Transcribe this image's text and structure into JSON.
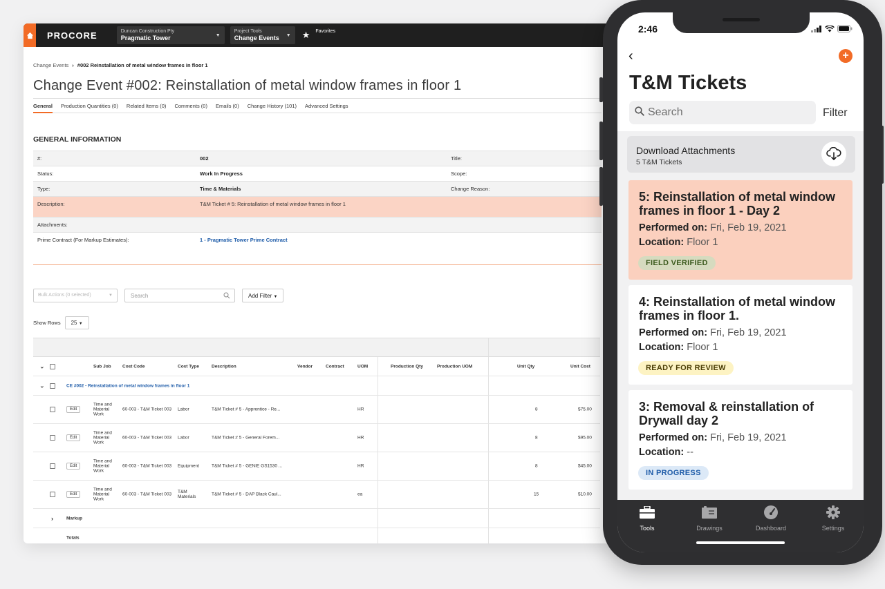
{
  "app": {
    "logo": "PROCORE",
    "company_small": "Duncan Construction Pty",
    "company_big": "Pragmatic Tower",
    "tools_small": "Project Tools",
    "tools_big": "Change Events",
    "favorites": "Favorites"
  },
  "breadcrumb": {
    "parent": "Change Events",
    "current": "#002 Reinstallation of metal window frames in floor 1"
  },
  "page_title": "Change Event #002: Reinstallation of metal window frames in floor 1",
  "tabs": [
    "General",
    "Production Quantities (0)",
    "Related Items (0)",
    "Comments (0)",
    "Emails (0)",
    "Change History (101)",
    "Advanced Settings"
  ],
  "general_info": {
    "heading": "GENERAL INFORMATION",
    "rows": [
      {
        "label": "#:",
        "value": "002",
        "label2": "Title:"
      },
      {
        "label": "Status:",
        "value": "Work In Progress",
        "label2": "Scope:"
      },
      {
        "label": "Type:",
        "value": "Time & Materials",
        "label2": "Change Reason:"
      },
      {
        "label": "Description:",
        "value": "T&M Ticket # 5: Reinstallation of metal window frames in floor 1",
        "label2": ""
      },
      {
        "label": "Attachments:",
        "value": "",
        "label2": ""
      },
      {
        "label": "Prime Contract (For Markup Estimates):",
        "value": "1 - Pragmatic Tower Prime Contract",
        "label2": ""
      }
    ]
  },
  "toolbar": {
    "bulk": "Bulk Actions (0 selected)",
    "search_placeholder": "Search",
    "add_filter": "Add Filter",
    "show_rows_label": "Show Rows",
    "show_rows_value": "25"
  },
  "grid": {
    "headers": {
      "sub_job": "Sub Job",
      "cost_code": "Cost Code",
      "cost_type": "Cost Type",
      "description": "Description",
      "vendor": "Vendor",
      "contract": "Contract",
      "uom": "UOM",
      "prod_qty": "Production Qty",
      "prod_uom": "Production UOM",
      "unit_qty": "Unit Qty",
      "unit_cost": "Unit Cost"
    },
    "group": "CE #002 - Reinstallation of metal window frames in floor 1",
    "edit_label": "Edit",
    "rows": [
      {
        "sub": "Time and Material Work",
        "code": "60-003 - T&M Ticket 003",
        "type": "Labor",
        "desc": "T&M Ticket # 5 - Apprentice - Re...",
        "uom": "HR",
        "qty": "8",
        "cost": "$75.00"
      },
      {
        "sub": "Time and Material Work",
        "code": "60-003 - T&M Ticket 003",
        "type": "Labor",
        "desc": "T&M Ticket # 5 - General Forem...",
        "uom": "HR",
        "qty": "8",
        "cost": "$95.00"
      },
      {
        "sub": "Time and Material Work",
        "code": "60-003 - T&M Ticket 003",
        "type": "Equipment",
        "desc": "T&M Ticket # 5 - GENIE GS1530 ...",
        "uom": "HR",
        "qty": "8",
        "cost": "$45.00"
      },
      {
        "sub": "Time and Material Work",
        "code": "60-003 - T&M Ticket 003",
        "type": "T&M Materials",
        "desc": "T&M Ticket # 5 - DAP Black Caul...",
        "uom": "ea",
        "qty": "15",
        "cost": "$10.00"
      }
    ],
    "markup": "Markup",
    "totals": "Totals"
  },
  "phone": {
    "time": "2:46",
    "title": "T&M Tickets",
    "search_placeholder": "Search",
    "filter": "Filter",
    "download_title": "Download Attachments",
    "download_sub": "5 T&M Tickets",
    "performed_label": "Performed on:",
    "location_label": "Location:",
    "cards": [
      {
        "title": "5: Reinstallation of metal window frames in floor 1 - Day 2",
        "date": "Fri, Feb 19, 2021",
        "location": "Floor 1",
        "badge": "FIELD VERIFIED",
        "badge_bg": "#d9dcc4",
        "badge_fg": "#3b5a1d"
      },
      {
        "title": "4: Reinstallation of metal window frames in floor 1.",
        "date": "Fri, Feb 19, 2021",
        "location": "Floor 1",
        "badge": "READY FOR REVIEW",
        "badge_bg": "#fdf3c3",
        "badge_fg": "#4a3d05"
      },
      {
        "title": "3: Removal & reinstallation of Drywall day 2",
        "date": "Fri, Feb 19, 2021",
        "location": "--",
        "badge": "IN PROGRESS",
        "badge_bg": "#dce9f7",
        "badge_fg": "#1d5ba8"
      }
    ],
    "tabbar": [
      "Tools",
      "Drawings",
      "Dashboard",
      "Settings"
    ]
  },
  "colors": {
    "accent": "#f26b26",
    "highlight": "#fbd4c5",
    "link": "#1d5ba8"
  }
}
